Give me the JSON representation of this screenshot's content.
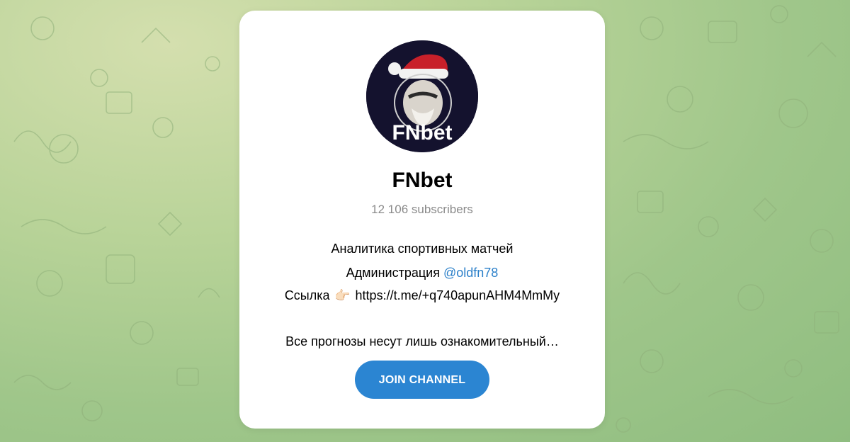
{
  "channel": {
    "title": "FNbet",
    "subscribers": "12 106 subscribers",
    "avatar_text": "FNbet"
  },
  "description": {
    "line1": "Аналитика спортивных матчей",
    "line2_prefix": "Администрация ",
    "line2_mention": "@oldfn78",
    "line3_prefix": "Ссылка ",
    "line3_emoji": "👉🏻",
    "line3_link": " https://t.me/+q740apunAHM4MmMy",
    "line4": "Все прогнозы несут лишь ознакомительный…"
  },
  "actions": {
    "join_label": "JOIN CHANNEL"
  },
  "colors": {
    "accent": "#2b85d2",
    "mention": "#2a7fc9",
    "avatar_bg": "#14122e"
  }
}
